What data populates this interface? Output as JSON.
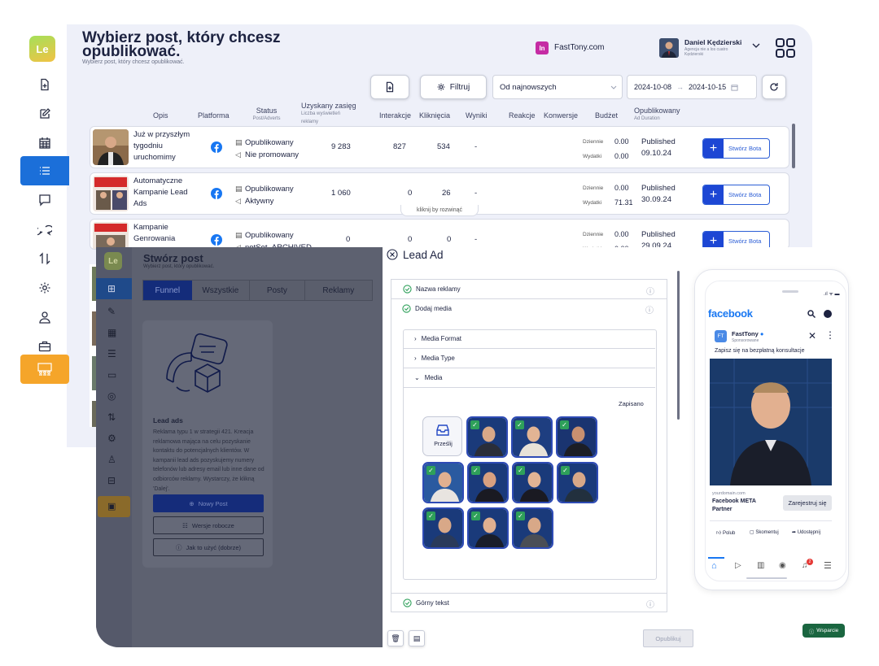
{
  "app": {
    "logo": "Le"
  },
  "header": {
    "title_line1": "Wybierz post, który chcesz",
    "title_line2": "opublikować.",
    "subtitle": "Wybierz post, który chcesz opublikować.",
    "page_badge": "In",
    "page_name": "FastTony.com",
    "user_name": "Daniel Kędzierski",
    "user_sub1": "Agencja nie a los cuatro",
    "user_sub2": "Kędzierski"
  },
  "toolbar": {
    "filter_label": "Filtruj",
    "sort_value": "Od najnowszych",
    "date_from": "2024-10-08",
    "date_arrow": "→",
    "date_to": "2024-10-15"
  },
  "columns": {
    "opis": "Opis",
    "platforma": "Platforma",
    "status": "Status",
    "status_sub": "Post/Adverts",
    "zasieg": "Uzyskany zasięg",
    "zasieg_sub1": "Liczba wyświetleń",
    "zasieg_sub2": "reklamy",
    "interakcje": "Interakcje",
    "klikniecia": "Kliknięcia",
    "wyniki": "Wyniki",
    "reakcje": "Reakcje",
    "konwersje": "Konwersje",
    "budzet": "Budżet",
    "opublikowany": "Opublikowany",
    "opublikowany_sub": "Ad Duration"
  },
  "rows": [
    {
      "desc": "Już w przyszłym tygodniu uruchomimy",
      "status1": "Opublikowany",
      "status2": "Nie promowany",
      "reach": "9 283",
      "interactions": "827",
      "clicks": "534",
      "results": "-",
      "daily_label": "Dziennie",
      "daily": "0.00",
      "spent_label": "Wydatki",
      "spent": "0.00",
      "published": "Published",
      "date": "09.10.24",
      "bota": "Stwórz Bota"
    },
    {
      "desc": "Automatyczne Kampanie Lead Ads",
      "status1": "Opublikowany",
      "status2": "Aktywny",
      "reach": "1 060",
      "interactions": "0",
      "clicks": "26",
      "results": "-",
      "daily_label": "Dziennie",
      "daily": "0.00",
      "spent_label": "Wydatki",
      "spent": "71.31",
      "published": "Published",
      "date": "30.09.24",
      "bota": "Stwórz Bota"
    },
    {
      "desc": "Kampanie Genrowania",
      "status1": "Opublikowany",
      "status2": "notSet_ARCHIVED",
      "reach": "0",
      "interactions": "0",
      "clicks": "0",
      "results": "-",
      "daily_label": "Dziennie",
      "daily": "0.00",
      "spent_label": "Wydatki",
      "spent": "0.00",
      "published": "Published",
      "date": "29.09.24",
      "bota": "Stwórz Bota"
    }
  ],
  "expand_hint": "kliknij by rozwinąć",
  "create_post": {
    "title": "Stwórz post",
    "subtitle": "Wybierz post, który opublikować.",
    "tabs": [
      "Funnel",
      "Wszystkie",
      "Posty",
      "Reklamy"
    ],
    "card_title": "Lead ads",
    "card_text": "Reklama typu 1 w strategii 421. Kreacja reklamowa mająca na celu pozyskanie kontaktu do potencjalnych klientów. W kampanii lead ads pozyskujemy numery telefonów lub adresy email lub inne dane od odbiorców reklamy. Wystarczy, że klikną 'Dalej'.",
    "btn_new": "Nowy Post",
    "btn_drafts": "Wersje robocze",
    "btn_howto": "Jak to użyć (dobrze)"
  },
  "lead_ad": {
    "title": "Lead Ad",
    "sec_name": "Nazwa reklamy",
    "sec_media": "Dodaj media",
    "sub_format": "Media Format",
    "sub_type": "Media Type",
    "sub_media": "Media",
    "saved": "Zapisano",
    "upload": "Prześlij",
    "sec_top_text": "Górny tekst",
    "publish": "Opublikuj"
  },
  "preview": {
    "brand": "facebook",
    "page": "FastTony",
    "sponsored": "Sponsorowane",
    "post_text": "Zapisz się na bezpłatną konsultacje",
    "domain": "yourdomain.com",
    "headline": "Facebook META Partner",
    "cta": "Zarejestruj się",
    "like": "Polub",
    "comment": "Skomentuj",
    "share": "Udostępnij",
    "notif_count": "2"
  },
  "support": {
    "label": "Wsparcie"
  },
  "colors": {
    "primary": "#1d47d4",
    "accent_orange": "#f5a52a",
    "active_blue": "#1b6fd9",
    "facebook": "#1877f2",
    "bg": "#eef0f9"
  }
}
